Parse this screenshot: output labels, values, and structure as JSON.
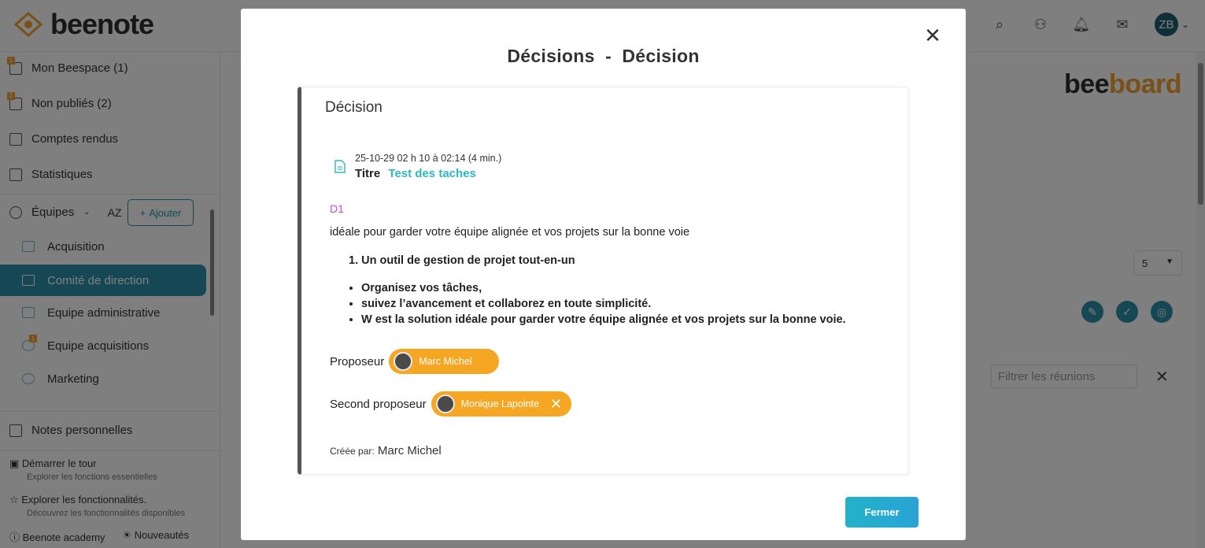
{
  "app": {
    "logo": "beenote",
    "brand_right": {
      "part1": "bee",
      "part2": "board"
    }
  },
  "topbar": {
    "avatar_initials": "ZB"
  },
  "sidebar": {
    "items": [
      {
        "label": "Mon Beespace (1)",
        "badge": "1",
        "icon": "grid-icon"
      },
      {
        "label": "Non publiés (2)",
        "badge": "2",
        "icon": "calendar-x-icon"
      },
      {
        "label": "Comptes rendus",
        "icon": "clipboard-icon"
      },
      {
        "label": "Statistiques",
        "icon": "chart-icon"
      }
    ],
    "teams_label": "Équipes",
    "sort_label": "AZ",
    "add_label": "Ajouter",
    "teams": [
      {
        "label": "Acquisition"
      },
      {
        "label": "Comité de direction",
        "active": true
      },
      {
        "label": "Equipe administrative"
      },
      {
        "label": "Equipe acquisitions",
        "badge": "1"
      },
      {
        "label": "Marketing"
      }
    ],
    "notes_label": "Notes personnelles",
    "tour": {
      "title": "Démarrer le tour",
      "subtitle": "Explorer les fonctions essentielles"
    },
    "features": {
      "title": "Explorer les fonctionnalités.",
      "subtitle": "Découvrez les fonctionnalités disponibles"
    },
    "academy": "Beenote academy",
    "news": "Nouveautés"
  },
  "background": {
    "select_value": "5",
    "filter_placeholder": "Filtrer les réunions"
  },
  "modal": {
    "title": "Décisions  -  Décision",
    "card_heading": "Décision",
    "meeting_date": "25-10-29 02 h 10 à 02:14 (4 min.)",
    "title_label": "Titre",
    "title_value": "Test des taches",
    "decision_code": "D1",
    "description": "idéale pour garder votre équipe alignée et vos projets sur la bonne voie",
    "ordered_item": "1. Un outil de gestion de projet tout-en-un",
    "bullets": [
      "Organisez vos tâches,",
      "suivez l’avancement et collaborez en toute simplicité.",
      "W est la solution idéale pour garder votre équipe alignée et vos projets sur la bonne voie."
    ],
    "proposer_label": "Proposeur",
    "proposer_name": "Marc Michel",
    "second_proposer_label": "Second proposeur",
    "second_proposer_name": "Monique Lapointe",
    "created_by_label": "Créée par",
    "created_by_name": "Marc Michel",
    "close_label": "Fermer"
  },
  "colors": {
    "accent": "#2b90a8",
    "chip": "#f5a623",
    "decision_code": "#c04fd6",
    "link": "#2eb8c6"
  }
}
